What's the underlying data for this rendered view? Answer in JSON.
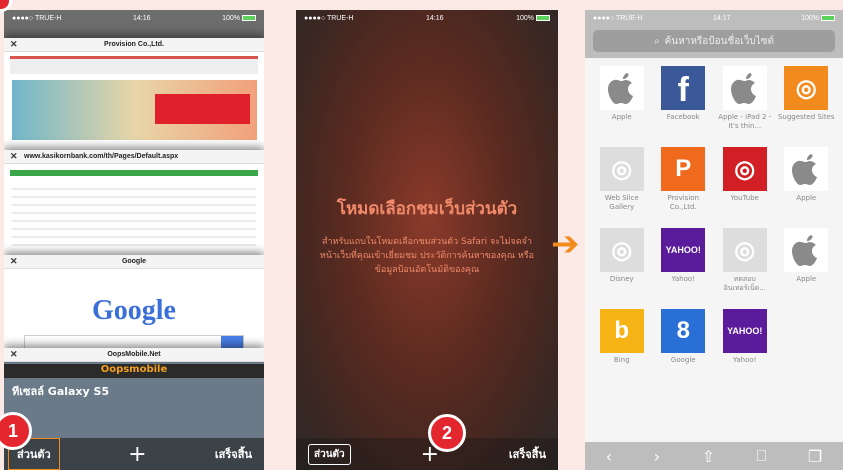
{
  "phone1": {
    "status": {
      "carrier": "●●●●○ TRUE-H",
      "time": "14:16",
      "battery": "100%"
    },
    "tabs": [
      {
        "title": "Provision Co.,Ltd."
      },
      {
        "title": "www.kasikornbank.com/th/Pages/Default.aspx"
      },
      {
        "title": "Google",
        "logo": "Google"
      },
      {
        "title": "OopsMobile.Net",
        "brand": "Oopsmobile",
        "headline": "ทีเซลล์ Galaxy S5"
      }
    ],
    "toolbar": {
      "private": "ส่วนตัว",
      "add": "+",
      "done": "เสร็จสิ้น"
    },
    "badge": "1"
  },
  "phone2": {
    "status": {
      "carrier": "●●●●○ TRUE-H",
      "time": "14:16",
      "battery": "100%"
    },
    "title": "โหมดเลือกชมเว็บส่วนตัว",
    "description": "สำหรับแถบในโหมดเลือกชมส่วนตัว Safari จะไม่จดจำหน้าเว็บที่คุณเข้าเยี่ยมชม ประวัติการค้นหาของคุณ หรือข้อมูลป้อนอัตโนมัติของคุณ",
    "toolbar": {
      "private": "ส่วนตัว",
      "add": "+",
      "done": "เสร็จสิ้น"
    },
    "badge": "2"
  },
  "phone3": {
    "status": {
      "carrier": "●●●●○ TRUE-H",
      "time": "14:17",
      "battery": "100%"
    },
    "search_placeholder": "ค้นหาหรือป้อนชื่อเว็บไซต์",
    "favorites": [
      {
        "label": "Apple",
        "icon": "apple-icon",
        "bg": "#ffffff",
        "fg": "#8a8a8a",
        "glyph": ""
      },
      {
        "label": "Facebook",
        "icon": "facebook-icon",
        "bg": "#3b5998",
        "fg": "#ffffff",
        "glyph": "f"
      },
      {
        "label": "Apple - iPad 2 - It's thin...",
        "icon": "apple-icon",
        "bg": "#ffffff",
        "fg": "#8a8a8a",
        "glyph": ""
      },
      {
        "label": "Suggested Sites",
        "icon": "compass-icon",
        "bg": "#f28a1e",
        "fg": "#ffffff",
        "glyph": "◎"
      },
      {
        "label": "Web Slice Gallery",
        "icon": "compass-icon",
        "bg": "#dddddd",
        "fg": "#ffffff",
        "glyph": "◎"
      },
      {
        "label": "Provision Co.,Ltd.",
        "icon": "provision-icon",
        "bg": "#f06a1e",
        "fg": "#ffffff",
        "glyph": "P"
      },
      {
        "label": "YouTube",
        "icon": "compass-icon",
        "bg": "#d21f25",
        "fg": "#ffffff",
        "glyph": "◎"
      },
      {
        "label": "Apple",
        "icon": "apple-icon",
        "bg": "#ffffff",
        "fg": "#8a8a8a",
        "glyph": ""
      },
      {
        "label": "Disney",
        "icon": "compass-icon",
        "bg": "#dddddd",
        "fg": "#ffffff",
        "glyph": "◎"
      },
      {
        "label": "Yahoo!",
        "icon": "yahoo-icon",
        "bg": "#5b1c9c",
        "fg": "#ffffff",
        "glyph": "YAHOO!"
      },
      {
        "label": "ทดสอบอินเทอร์เน็ต...",
        "icon": "compass-icon",
        "bg": "#dddddd",
        "fg": "#ffffff",
        "glyph": "◎"
      },
      {
        "label": "Apple",
        "icon": "apple-icon",
        "bg": "#ffffff",
        "fg": "#8a8a8a",
        "glyph": ""
      },
      {
        "label": "Bing",
        "icon": "bing-icon",
        "bg": "#f5b316",
        "fg": "#ffffff",
        "glyph": "b"
      },
      {
        "label": "Google",
        "icon": "google-icon",
        "bg": "#2a6fd6",
        "fg": "#ffffff",
        "glyph": "8"
      },
      {
        "label": "Yahoo!",
        "icon": "yahoo-icon",
        "bg": "#5b1c9c",
        "fg": "#ffffff",
        "glyph": "YAHOO!"
      }
    ],
    "bottom_icons": [
      "back-icon",
      "forward-icon",
      "share-icon",
      "bookmarks-icon",
      "tabs-icon"
    ]
  }
}
